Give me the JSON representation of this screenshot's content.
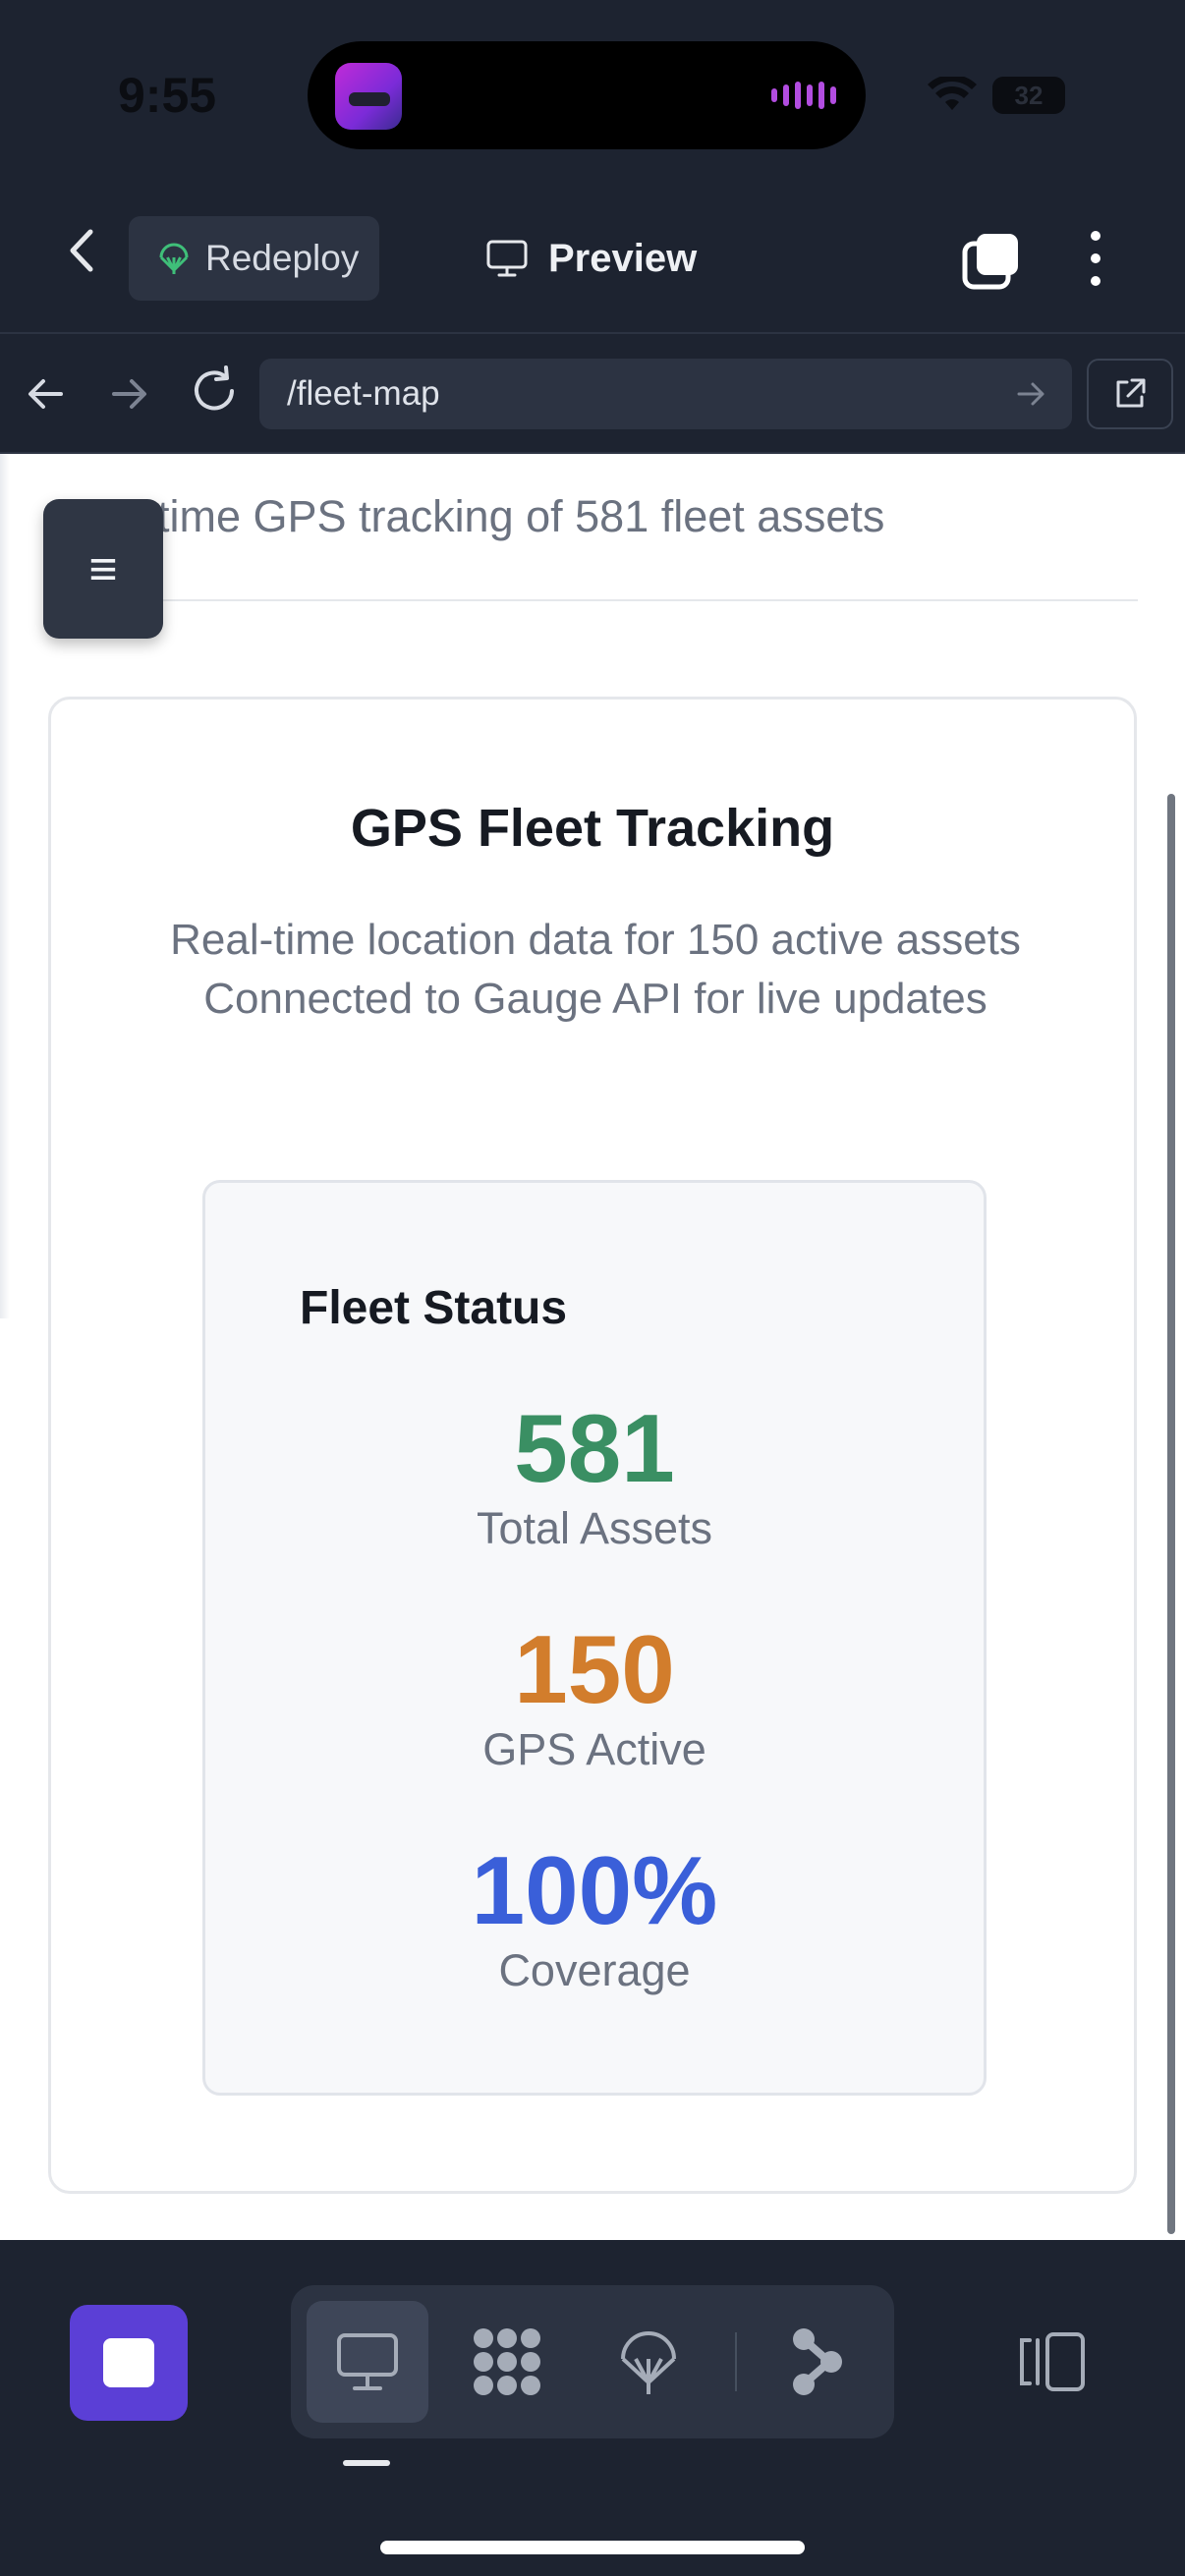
{
  "status_bar": {
    "time": "9:55",
    "battery": "32"
  },
  "header": {
    "redeploy_label": "Redeploy",
    "title": "Preview"
  },
  "url_bar": {
    "path": "/fleet-map"
  },
  "page": {
    "subtitle": "time GPS tracking of 581 fleet assets",
    "menu_glyph": "≡",
    "card": {
      "title": "GPS Fleet Tracking",
      "description_line1": "Real-time location data for 150 active assets",
      "description_line2": "Connected to Gauge API for live updates",
      "status_panel": {
        "title": "Fleet Status",
        "stats": [
          {
            "value": "581",
            "label": "Total Assets",
            "color": "#3a8f63"
          },
          {
            "value": "150",
            "label": "GPS Active",
            "color": "#d27d2c"
          },
          {
            "value": "100%",
            "label": "Coverage",
            "color": "#3a5fd9"
          }
        ]
      }
    }
  },
  "toolbar": {
    "accent_color": "#5b3fd6",
    "views": [
      "monitor-icon",
      "apps-grid-icon",
      "deploy-icon",
      "branch-icon"
    ],
    "active_view": "monitor-icon"
  }
}
